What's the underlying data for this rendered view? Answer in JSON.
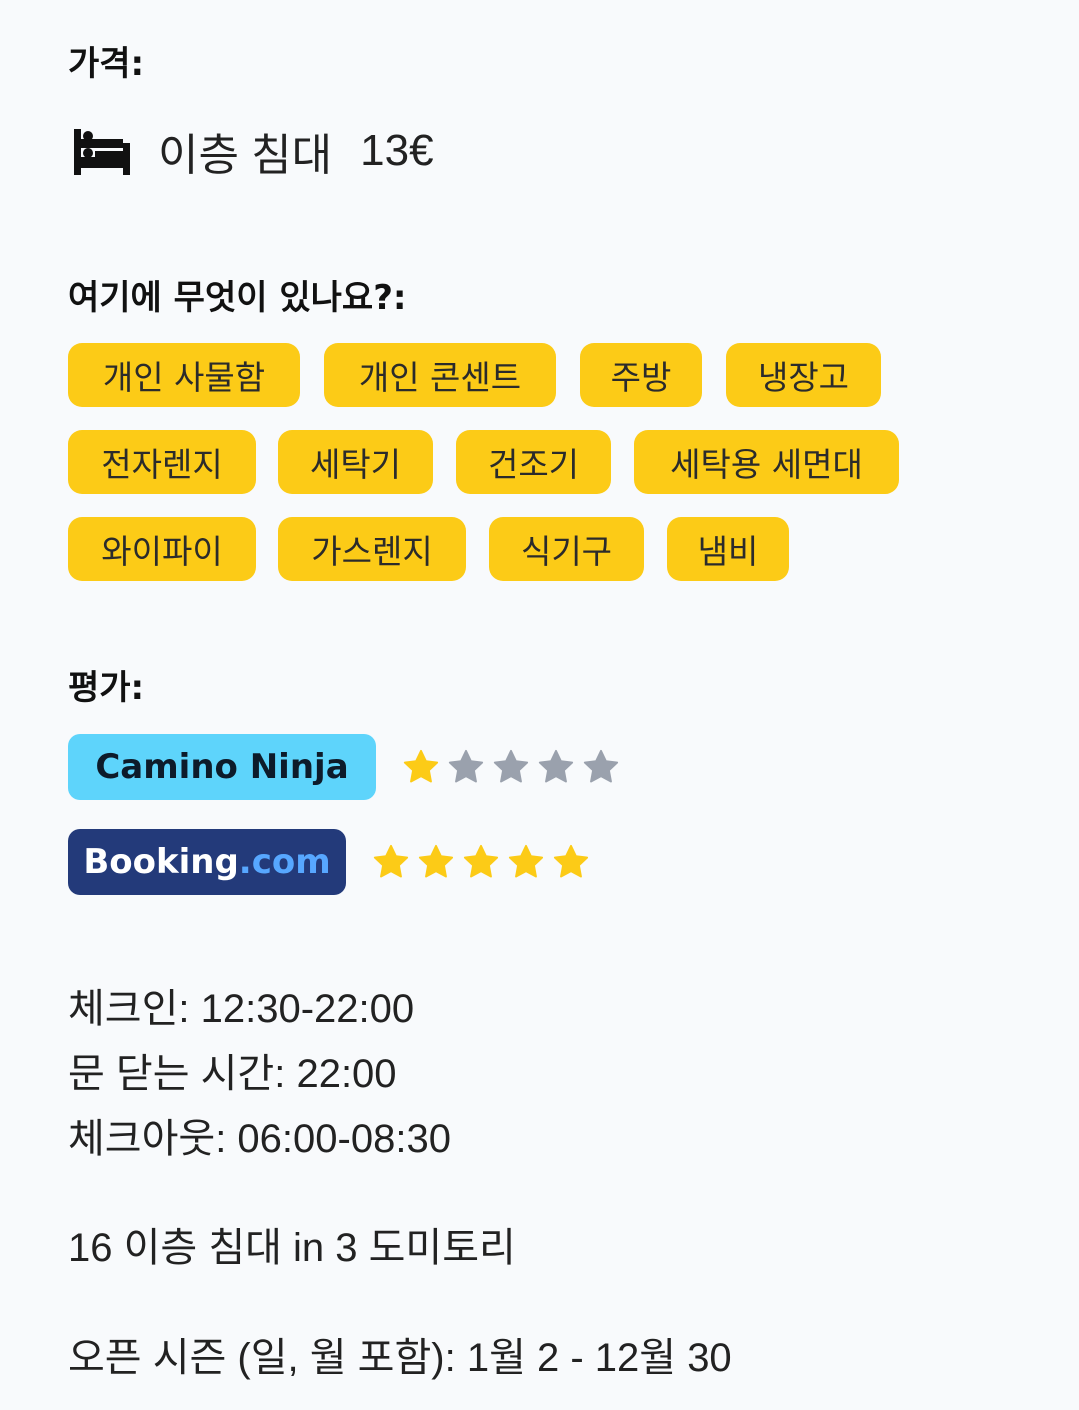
{
  "price": {
    "title": "가격:",
    "bed_icon": "bunk-bed-icon",
    "bed_label": "이층 침대",
    "bed_price": "13€"
  },
  "amenities": {
    "title": "여기에 무엇이 있나요?:",
    "rows": [
      [
        "개인 사물함",
        "개인 콘센트",
        "주방",
        "냉장고"
      ],
      [
        "전자렌지",
        "세탁기",
        "건조기",
        "세탁용 세면대"
      ],
      [
        "와이파이",
        "가스렌지",
        "식기구",
        "냄비"
      ]
    ],
    "tag_color": "#fccb17"
  },
  "ratings": {
    "title": "평가:",
    "camino_ninja": {
      "label": "Camino Ninja",
      "color": "#5ed4fb",
      "stars": 1,
      "max_stars": 5
    },
    "booking": {
      "label_main": "Booking",
      "label_suffix": ".com",
      "color": "#233a7a",
      "stars": 5,
      "max_stars": 5
    },
    "star_on_color": "#fccb17",
    "star_off_color": "#9aa1ad"
  },
  "schedule": {
    "checkin": "체크인: 12:30-22:00",
    "door_close": "문 닫는 시간: 22:00",
    "checkout": "체크아웃: 06:00-08:30"
  },
  "capacity": "16 이층 침대 in 3 도미토리",
  "season": "오픈 시즌 (일, 월 포함): 1월 2 - 12월 30"
}
